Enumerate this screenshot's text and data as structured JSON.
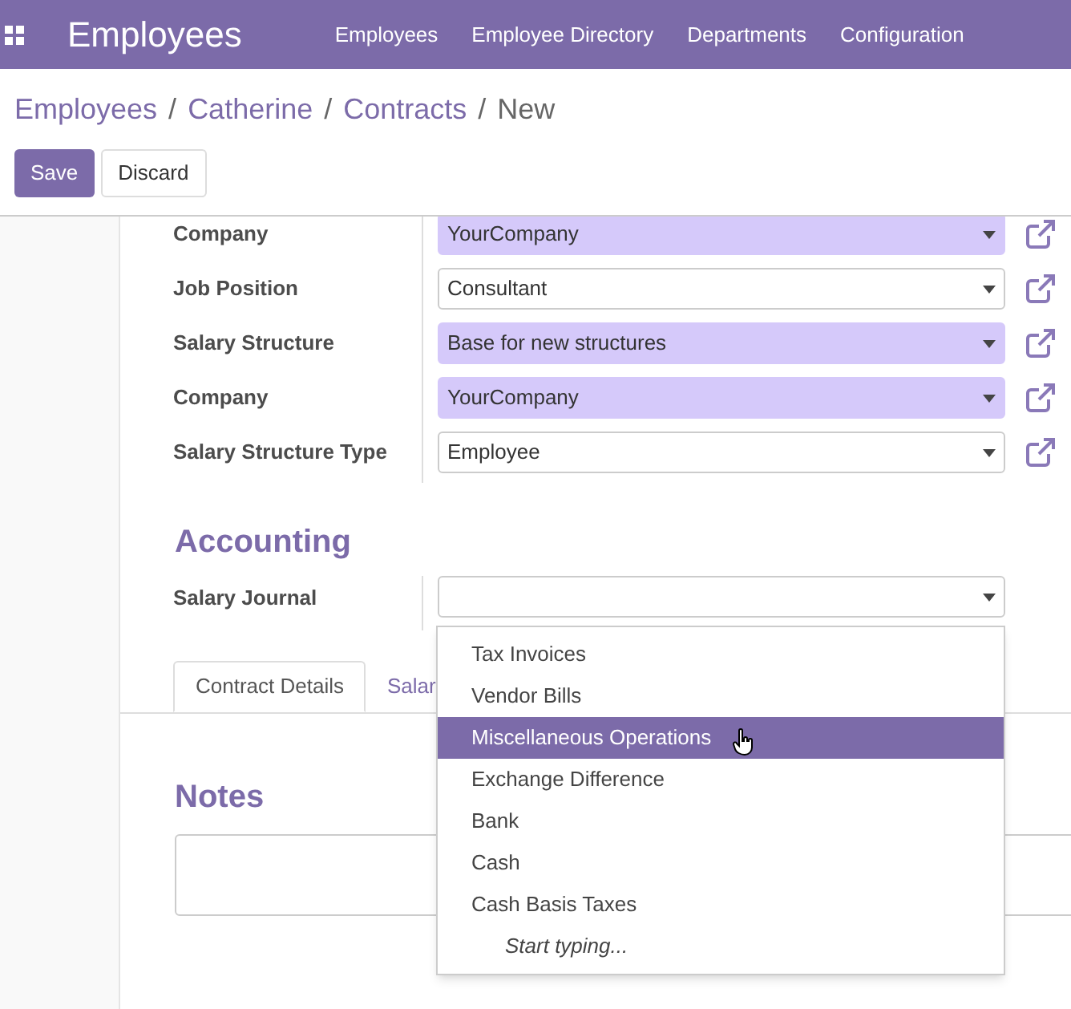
{
  "navbar": {
    "app_title": "Employees",
    "menu": [
      "Employees",
      "Employee Directory",
      "Departments",
      "Configuration"
    ]
  },
  "breadcrumb": [
    {
      "label": "Employees",
      "kind": "link"
    },
    {
      "label": "/",
      "kind": "separator"
    },
    {
      "label": "Catherine",
      "kind": "link"
    },
    {
      "label": "/",
      "kind": "separator"
    },
    {
      "label": "Contracts",
      "kind": "link"
    },
    {
      "label": "/",
      "kind": "separator"
    },
    {
      "label": "New",
      "kind": "current"
    }
  ],
  "buttons": [
    {
      "label": "Save",
      "kind": "primary"
    },
    {
      "label": "Discard",
      "kind": "secondary"
    }
  ],
  "fields": [
    {
      "label": "Company",
      "value": "YourCompany",
      "required": true
    },
    {
      "label": "Job Position",
      "value": "Consultant",
      "required": false
    },
    {
      "label": "Salary Structure",
      "value": "Base for new structures",
      "required": true
    },
    {
      "label": "Company",
      "value": "YourCompany",
      "required": true
    },
    {
      "label": "Salary Structure Type",
      "value": "Employee",
      "required": false
    }
  ],
  "accounting": {
    "heading": "Accounting",
    "field": {
      "label": "Salary Journal"
    }
  },
  "dropdown": {
    "options": [
      {
        "label": "Tax Invoices",
        "selected": false
      },
      {
        "label": "Vendor Bills",
        "selected": false
      },
      {
        "label": "Miscellaneous Operations",
        "selected": true
      },
      {
        "label": "Exchange Difference",
        "selected": false
      },
      {
        "label": "Bank",
        "selected": false
      },
      {
        "label": "Cash",
        "selected": false
      },
      {
        "label": "Cash Basis Taxes",
        "selected": false
      }
    ],
    "hint": "Start typing..."
  },
  "tabs": [
    {
      "label": "Contract Details",
      "selected": true
    },
    {
      "label": "Salar",
      "selected": false
    }
  ],
  "notes": {
    "heading": "Notes"
  }
}
